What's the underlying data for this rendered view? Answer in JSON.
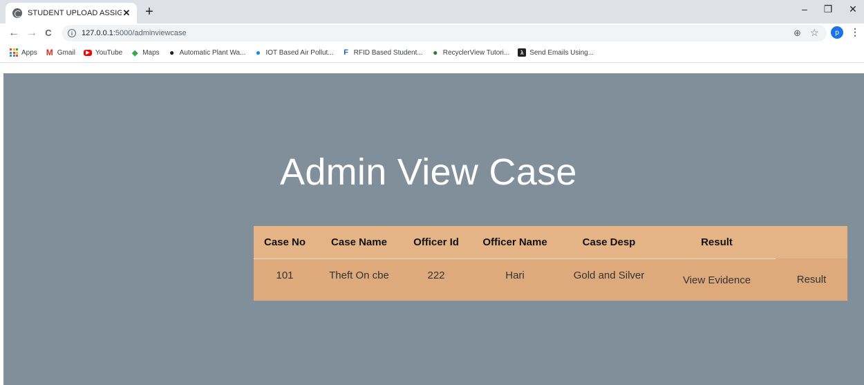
{
  "browser": {
    "tab_title": "STUDENT UPLOAD ASSIGNMENT",
    "tab_close": "✕",
    "new_tab": "+",
    "window_controls": {
      "minimize": "–",
      "restore": "❐",
      "close": "✕"
    },
    "nav": {
      "back": "←",
      "forward": "→",
      "reload": "C"
    },
    "url_host": "127.0.0.1",
    "url_path": ":5000/adminviewcase",
    "profile_initial": "p",
    "menu": "⋮",
    "zoom_icon": "⊕",
    "star_icon": "☆",
    "bookmarks": [
      {
        "label": "Apps",
        "icon": "apps-grid-icon"
      },
      {
        "label": "Gmail",
        "icon": "gmail-icon",
        "glyph": "M",
        "color": "#d93025"
      },
      {
        "label": "YouTube",
        "icon": "youtube-icon",
        "glyph": "▶",
        "color": "#ff0000"
      },
      {
        "label": "Maps",
        "icon": "maps-icon",
        "glyph": "◆",
        "color": "#34a853"
      },
      {
        "label": "Automatic Plant Wa...",
        "icon": "plant-icon",
        "glyph": "●",
        "color": "#202124"
      },
      {
        "label": "IOT Based Air Pollut...",
        "icon": "globe-icon",
        "glyph": "●",
        "color": "#1e88e5"
      },
      {
        "label": "RFID Based Student...",
        "icon": "rfid-icon",
        "glyph": "F",
        "color": "#1565c0"
      },
      {
        "label": "RecyclerView Tutori...",
        "icon": "recycler-icon",
        "glyph": "●",
        "color": "#2e7d32"
      },
      {
        "label": "Send Emails Using...",
        "icon": "email-icon",
        "glyph": "λ",
        "color": "#202124"
      }
    ]
  },
  "page": {
    "title": "Admin View Case",
    "table": {
      "headers": [
        "Case No",
        "Case Name",
        "Officer Id",
        "Officer Name",
        "Case Desp",
        "Result",
        ""
      ],
      "rows": [
        {
          "case_no": "101",
          "case_name": "Theft On cbe",
          "officer_id": "222",
          "officer_name": "Hari",
          "case_desp": "Gold and Silver",
          "evidence_link": "View Evidence",
          "result_link": "Result"
        }
      ]
    }
  },
  "colors": {
    "page_bg": "#808f9a",
    "table_row_bg": "#dea97b",
    "table_header_bg": "#e4b487"
  }
}
